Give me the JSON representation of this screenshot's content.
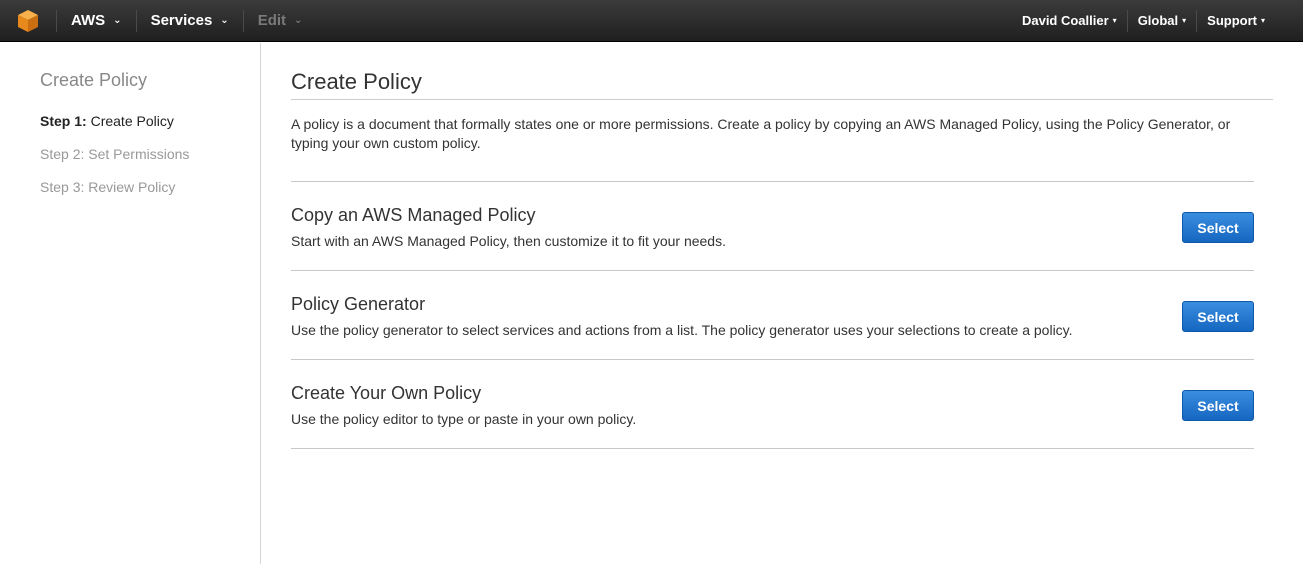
{
  "topbar": {
    "logo_icon": "aws-cube-icon",
    "aws_label": "AWS",
    "services_label": "Services",
    "edit_label": "Edit",
    "user_label": "David Coallier",
    "region_label": "Global",
    "support_label": "Support"
  },
  "sidebar": {
    "title": "Create Policy",
    "steps": [
      {
        "num": "Step 1:",
        "label": "Create Policy",
        "active": true
      },
      {
        "num": "Step 2:",
        "label": "Set Permissions",
        "active": false
      },
      {
        "num": "Step 3:",
        "label": "Review Policy",
        "active": false
      }
    ]
  },
  "main": {
    "title": "Create Policy",
    "intro": "A policy is a document that formally states one or more permissions. Create a policy by copying an AWS Managed Policy, using the Policy Generator, or typing your own custom policy.",
    "options": [
      {
        "title": "Copy an AWS Managed Policy",
        "desc": "Start with an AWS Managed Policy, then customize it to fit your needs.",
        "button": "Select"
      },
      {
        "title": "Policy Generator",
        "desc": "Use the policy generator to select services and actions from a list. The policy generator uses your selections to create a policy.",
        "button": "Select"
      },
      {
        "title": "Create Your Own Policy",
        "desc": "Use the policy editor to type or paste in your own policy.",
        "button": "Select"
      }
    ]
  },
  "colors": {
    "accent_orange": "#f59a23",
    "button_blue": "#1f74cf",
    "topbar_bg": "#2b2b2b"
  }
}
